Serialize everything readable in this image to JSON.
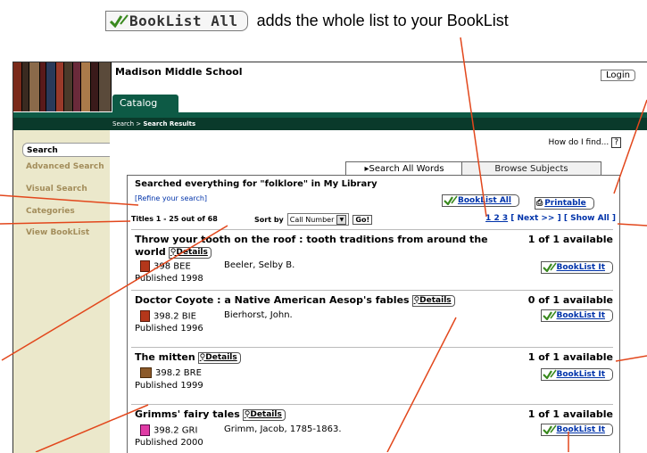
{
  "caption": {
    "button_label": "BookList All",
    "text": "adds the whole list to your BookList"
  },
  "header": {
    "school": "Madison Middle School",
    "login": "Login",
    "tab": "Catalog",
    "breadcrumb_link": "Search",
    "breadcrumb_sep": " > ",
    "breadcrumb_current": "Search Results",
    "help_text": "How do I find...",
    "help_btn": "?"
  },
  "sidebar": {
    "items": [
      "Search",
      "Advanced Search",
      "Visual Search",
      "Categories",
      "View BookList"
    ]
  },
  "tabs": [
    "Search All Words",
    "Browse Subjects"
  ],
  "results": {
    "searched": "Searched everything for \"folklore\" in My Library",
    "refine": "[Refine your search]",
    "booklist_all": "BookList All",
    "printable": "Printable",
    "titles_range": "Titles 1 - 25 out of 68",
    "sort_label": "Sort by",
    "sort_value": "Call Number",
    "go": "Go!",
    "pager_pages": "1 2 3",
    "pager_next": "[ Next >> ]",
    "pager_all": "[ Show All ]",
    "details_label": "Details",
    "booklist_it": "BookList It",
    "items": [
      {
        "title": "Throw your tooth on the roof : tooth traditions from around the world",
        "call": "398 BEE",
        "author": "Beeler, Selby B.",
        "published": "Published 1998",
        "availability": "1 of 1 available",
        "icon": "book-icon"
      },
      {
        "title": "Doctor Coyote : a Native American Aesop's fables",
        "call": "398.2 BIE",
        "author": "Bierhorst, John.",
        "published": "Published 1996",
        "availability": "0 of 1 available",
        "icon": "book-icon"
      },
      {
        "title": "The mitten",
        "call": "398.2 BRE",
        "author": "",
        "published": "Published 1999",
        "availability": "1 of 1 available",
        "icon": "film-icon"
      },
      {
        "title": "Grimms' fairy tales",
        "call": "398.2 GRI",
        "author": "Grimm, Jacob, 1785-1863.",
        "published": "Published 2000",
        "availability": "1 of 1 available",
        "icon": "magazine-icon"
      }
    ]
  },
  "colors": {
    "header_green": "#0d5a45",
    "sidebar_bg": "#ebe8cb",
    "callout": "#e2471c",
    "link": "#0033aa"
  }
}
